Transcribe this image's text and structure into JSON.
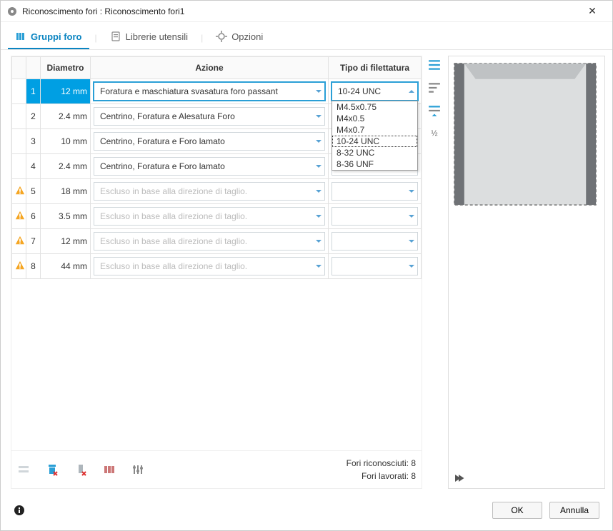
{
  "window": {
    "title": "Riconoscimento fori : Riconoscimento fori1"
  },
  "tabs": {
    "groups": "Gruppi foro",
    "tools": "Librerie utensili",
    "options": "Opzioni"
  },
  "columns": {
    "diameter": "Diametro",
    "action": "Azione",
    "thread": "Tipo di filettatura"
  },
  "rows": [
    {
      "idx": "1",
      "diameter": "12 mm",
      "action": "Foratura e maschiatura svasatura foro passant",
      "thread": "10-24 UNC",
      "selected": true,
      "enabled": true,
      "threadOpen": true,
      "warn": false
    },
    {
      "idx": "2",
      "diameter": "2.4 mm",
      "action": "Centrino, Foratura e Alesatura Foro",
      "thread": "",
      "selected": false,
      "enabled": true,
      "threadOpen": false,
      "warn": false
    },
    {
      "idx": "3",
      "diameter": "10 mm",
      "action": "Centrino, Foratura e Foro lamato",
      "thread": "",
      "selected": false,
      "enabled": true,
      "threadOpen": false,
      "warn": false
    },
    {
      "idx": "4",
      "diameter": "2.4 mm",
      "action": "Centrino, Foratura e Foro lamato",
      "thread": "",
      "selected": false,
      "enabled": true,
      "threadOpen": false,
      "warn": false
    },
    {
      "idx": "5",
      "diameter": "18 mm",
      "action": "Escluso in base alla direzione di taglio.",
      "thread": "",
      "selected": false,
      "enabled": false,
      "threadOpen": false,
      "warn": true
    },
    {
      "idx": "6",
      "diameter": "3.5 mm",
      "action": "Escluso in base alla direzione di taglio.",
      "thread": "",
      "selected": false,
      "enabled": false,
      "threadOpen": false,
      "warn": true
    },
    {
      "idx": "7",
      "diameter": "12 mm",
      "action": "Escluso in base alla direzione di taglio.",
      "thread": "",
      "selected": false,
      "enabled": false,
      "threadOpen": false,
      "warn": true
    },
    {
      "idx": "8",
      "diameter": "44 mm",
      "action": "Escluso in base alla direzione di taglio.",
      "thread": "",
      "selected": false,
      "enabled": false,
      "threadOpen": false,
      "warn": true
    }
  ],
  "thread_options": [
    "M4.5x0.75",
    "M4x0.5",
    "M4x0.7",
    "10-24 UNC",
    "8-32 UNC",
    "8-36 UNF"
  ],
  "thread_highlight": "10-24 UNC",
  "status": {
    "recognized_label": "Fori riconosciuti:",
    "recognized_value": "8",
    "machined_label": "Fori lavorati:",
    "machined_value": "8"
  },
  "footer": {
    "ok": "OK",
    "cancel": "Annulla"
  }
}
